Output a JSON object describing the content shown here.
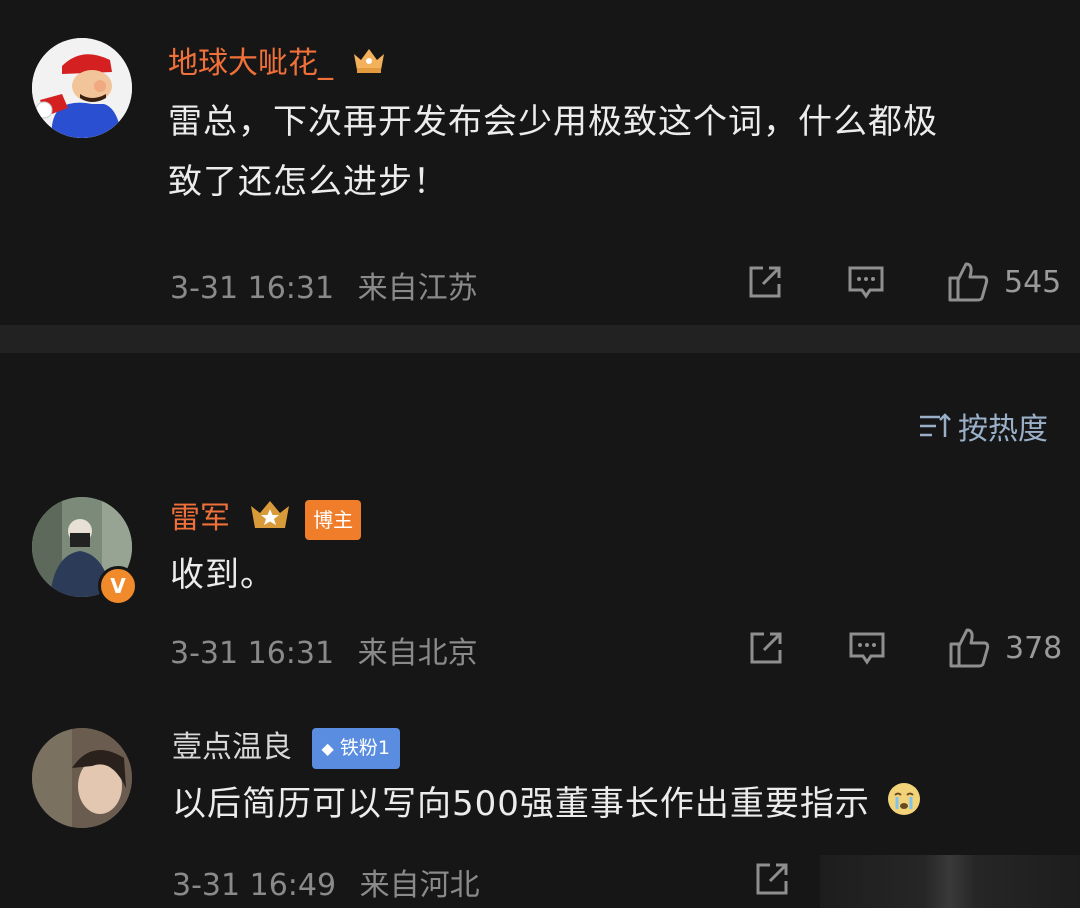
{
  "comments": [
    {
      "username": "地球大呲花_",
      "text_line1": "雷总，下次再开发布会少用极致这个词，什么都极",
      "text_line2": "致了还怎么进步！",
      "time": "3-31 16:31",
      "location": "来自江苏",
      "likes": "545",
      "name_color": "#f0703a",
      "badge_icon": "crown-icon"
    },
    {
      "username": "雷军",
      "badge_label": "博主",
      "text_line1": "收到。",
      "time": "3-31 16:31",
      "location": "来自北京",
      "likes": "378",
      "name_color": "#f0703a",
      "badge_icon": "crown-star-icon",
      "verified_icon": "verified-v-icon"
    },
    {
      "username": "壹点温良",
      "badge_label": "铁粉1",
      "text_line1": "以后简历可以写向500强董事长作出重要指示",
      "emoji": "crying-face-icon",
      "time": "3-31 16:49",
      "location": "来自河北",
      "name_color": "#d8d8d8",
      "badge_icon": "diamond-icon"
    }
  ],
  "sort": {
    "label": "按热度",
    "icon": "sort-lines-icon"
  }
}
